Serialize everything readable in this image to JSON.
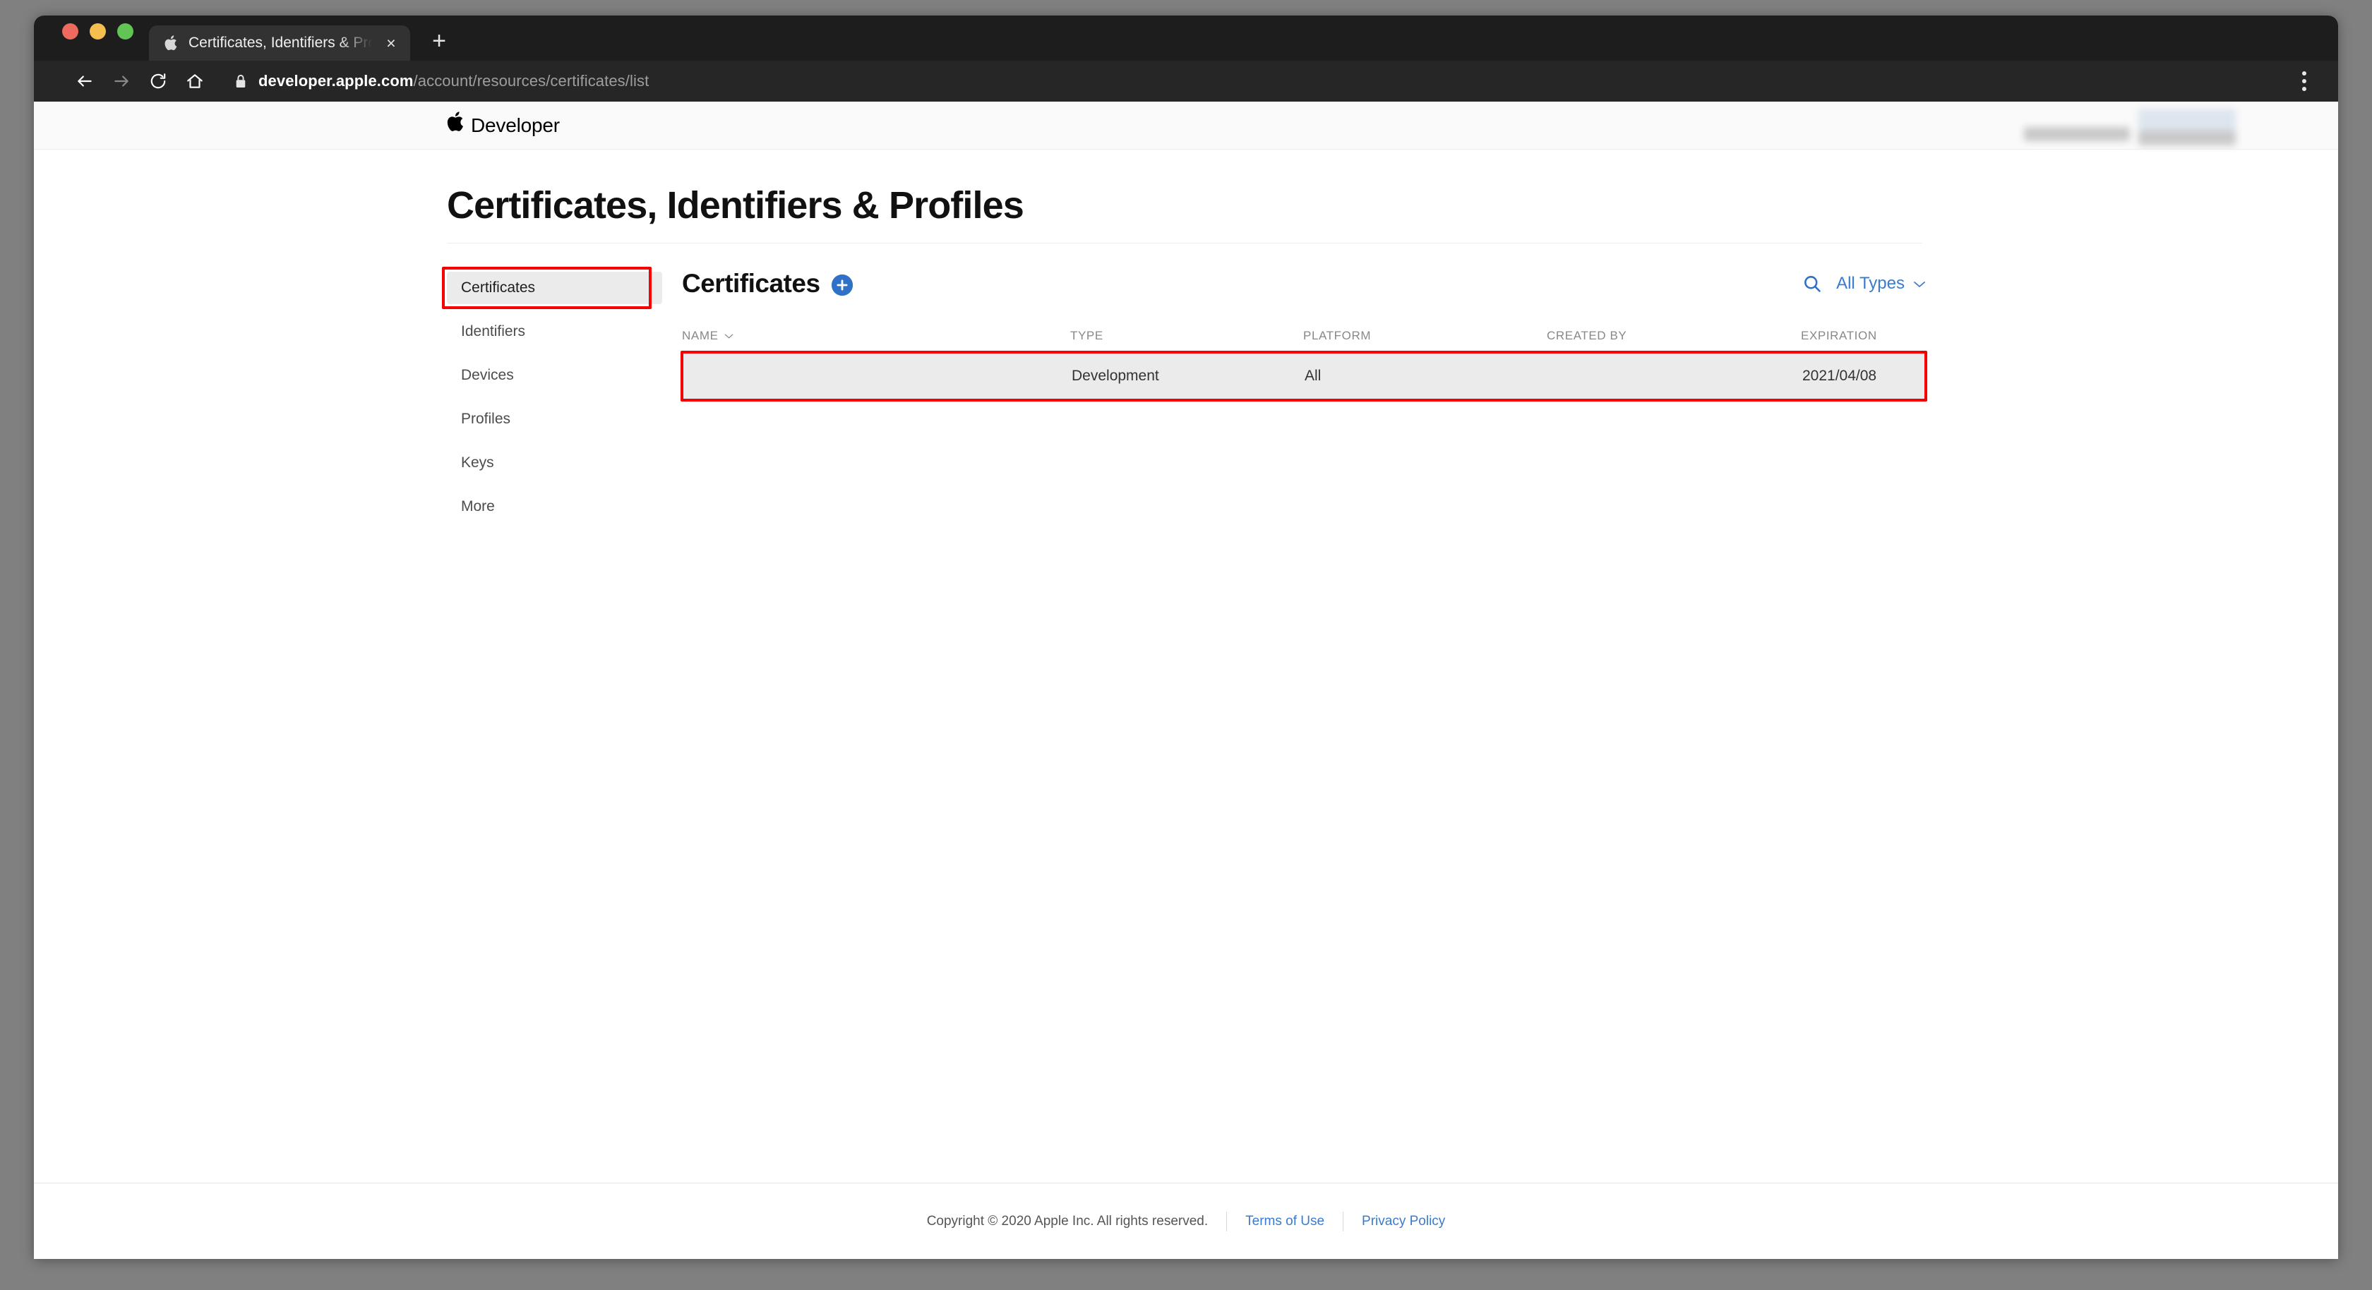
{
  "browser": {
    "tab": {
      "title": "Certificates, Identifiers & Profiles",
      "favicon": "apple-icon",
      "close_label": "×"
    },
    "new_tab_label": "+",
    "nav": {
      "back": "back-arrow-icon",
      "forward": "forward-arrow-icon",
      "reload": "reload-icon",
      "home": "home-icon"
    },
    "omnibox": {
      "lock": "lock-icon",
      "url_host": "developer.apple.com",
      "url_path": "/account/resources/certificates/list"
    },
    "menu_label": "browser-menu"
  },
  "site_header": {
    "apple_glyph": "",
    "brand": "Developer"
  },
  "page": {
    "title": "Certificates, Identifiers & Profiles"
  },
  "sidebar": {
    "items": [
      {
        "label": "Certificates",
        "active": true
      },
      {
        "label": "Identifiers",
        "active": false
      },
      {
        "label": "Devices",
        "active": false
      },
      {
        "label": "Profiles",
        "active": false
      },
      {
        "label": "Keys",
        "active": false
      },
      {
        "label": "More",
        "active": false
      }
    ]
  },
  "main": {
    "panel_title": "Certificates",
    "add_button_label": "+",
    "search_icon": "search-icon",
    "filter": {
      "selected": "All Types",
      "chevron": "chevron-down-icon"
    },
    "table": {
      "columns": [
        {
          "key": "name",
          "label": "NAME",
          "sortable": true
        },
        {
          "key": "type",
          "label": "TYPE",
          "sortable": false
        },
        {
          "key": "platform",
          "label": "PLATFORM",
          "sortable": false
        },
        {
          "key": "created_by",
          "label": "CREATED BY",
          "sortable": false
        },
        {
          "key": "expiration",
          "label": "EXPIRATION",
          "sortable": false
        }
      ],
      "rows": [
        {
          "name": "",
          "name_redacted": true,
          "type": "Development",
          "platform": "All",
          "created_by": "",
          "created_by_redacted": true,
          "expiration": "2021/04/08",
          "highlighted": true
        }
      ]
    }
  },
  "footer": {
    "copyright": "Copyright © 2020 Apple Inc. All rights reserved.",
    "links": [
      {
        "label": "Terms of Use"
      },
      {
        "label": "Privacy Policy"
      }
    ]
  },
  "annotations": {
    "highlight_color": "#f40000",
    "targets": [
      "sidebar-item-certificates",
      "certificate-table-row"
    ]
  }
}
